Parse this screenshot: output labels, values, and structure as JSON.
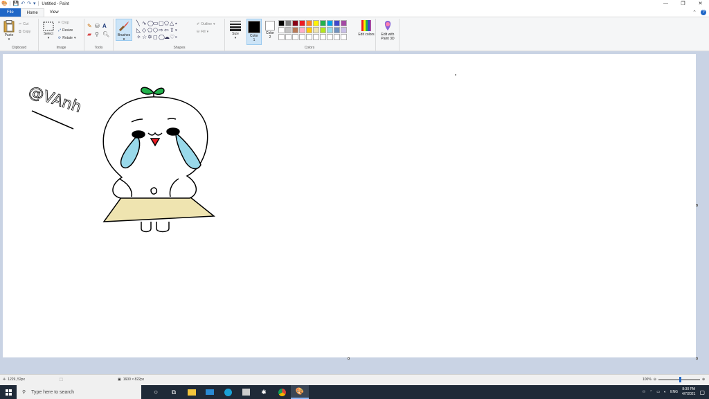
{
  "window": {
    "title": "Untitled - Paint",
    "controls": [
      "—",
      "❐",
      "✕"
    ]
  },
  "tabs": [
    {
      "label": "File"
    },
    {
      "label": "Home"
    },
    {
      "label": "View"
    }
  ],
  "ribbon": {
    "clipboard": {
      "label": "Clipboard",
      "paste": "Paste",
      "cut": "Cut",
      "copy": "Copy"
    },
    "image": {
      "label": "Image",
      "select": "Select",
      "crop": "Crop",
      "resize": "Resize",
      "rotate": "Rotate"
    },
    "tools": {
      "label": "Tools"
    },
    "brushes": {
      "label": "Brushes"
    },
    "shapes": {
      "label": "Shapes",
      "outline": "Outline",
      "fill": "Fill"
    },
    "size": {
      "label": "Size"
    },
    "color1": {
      "label": "Color",
      "sub": "1",
      "value": "#000000"
    },
    "color2": {
      "label": "Color",
      "sub": "2",
      "value": "#ffffff"
    },
    "colors": {
      "label": "Colors",
      "edit": "Edit colors"
    },
    "paint3d": {
      "label": "Edit with Paint 3D"
    }
  },
  "palette": [
    "#000000",
    "#7f7f7f",
    "#880015",
    "#ed1c24",
    "#ff7f27",
    "#fff200",
    "#22b14c",
    "#00a2e8",
    "#3f48cc",
    "#a349a4",
    "#ffffff",
    "#c3c3c3",
    "#b97a57",
    "#ffaec9",
    "#ffc90e",
    "#efe4b0",
    "#b5e61d",
    "#99d9ea",
    "#7092be",
    "#c8bfe7",
    "#ffffff",
    "#ffffff",
    "#ffffff",
    "#ffffff",
    "#ffffff",
    "#ffffff",
    "#ffffff",
    "#ffffff",
    "#ffffff",
    "#ffffff"
  ],
  "status": {
    "cursor": "1229, 52px",
    "canvas_size": "1600 × 822px",
    "zoom": "100%"
  },
  "taskbar": {
    "search_placeholder": "Type here to search",
    "lang": "ENG",
    "time": "8:30 PM",
    "date": "4/7/2021"
  },
  "drawing": {
    "signature": "@VAnh",
    "colors": {
      "leaf": "#22b14c",
      "tears": "#99d9ea",
      "skirt": "#efe4b0",
      "mouth": "#ed1c24"
    }
  }
}
